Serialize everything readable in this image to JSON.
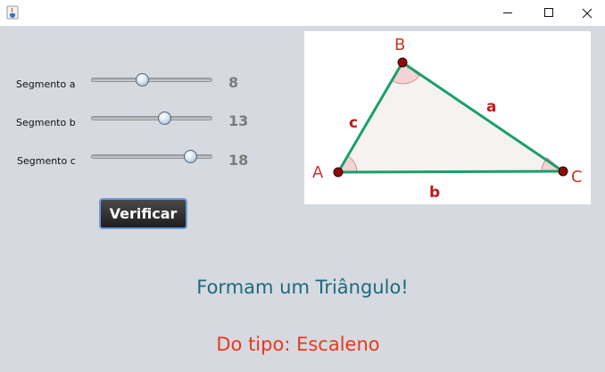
{
  "sliders": [
    {
      "label": "Segmento a",
      "value": "8",
      "position": 0.41
    },
    {
      "label": "Segmento b",
      "value": "13",
      "position": 0.62
    },
    {
      "label": "Segmento c",
      "value": "18",
      "position": 0.86
    }
  ],
  "verify_button": "Verificar",
  "diagram": {
    "vertex_a": "A",
    "vertex_b": "B",
    "vertex_c": "C",
    "side_a": "a",
    "side_b": "b",
    "side_c": "c"
  },
  "result": {
    "main": "Formam um Triângulo!",
    "type": "Do tipo: Escaleno"
  },
  "colors": {
    "triangle_edge": "#1aa06a",
    "vertex_label": "#c0392b",
    "side_label": "#c01818",
    "result_main": "#1c6b7a",
    "result_type": "#e8391d"
  }
}
